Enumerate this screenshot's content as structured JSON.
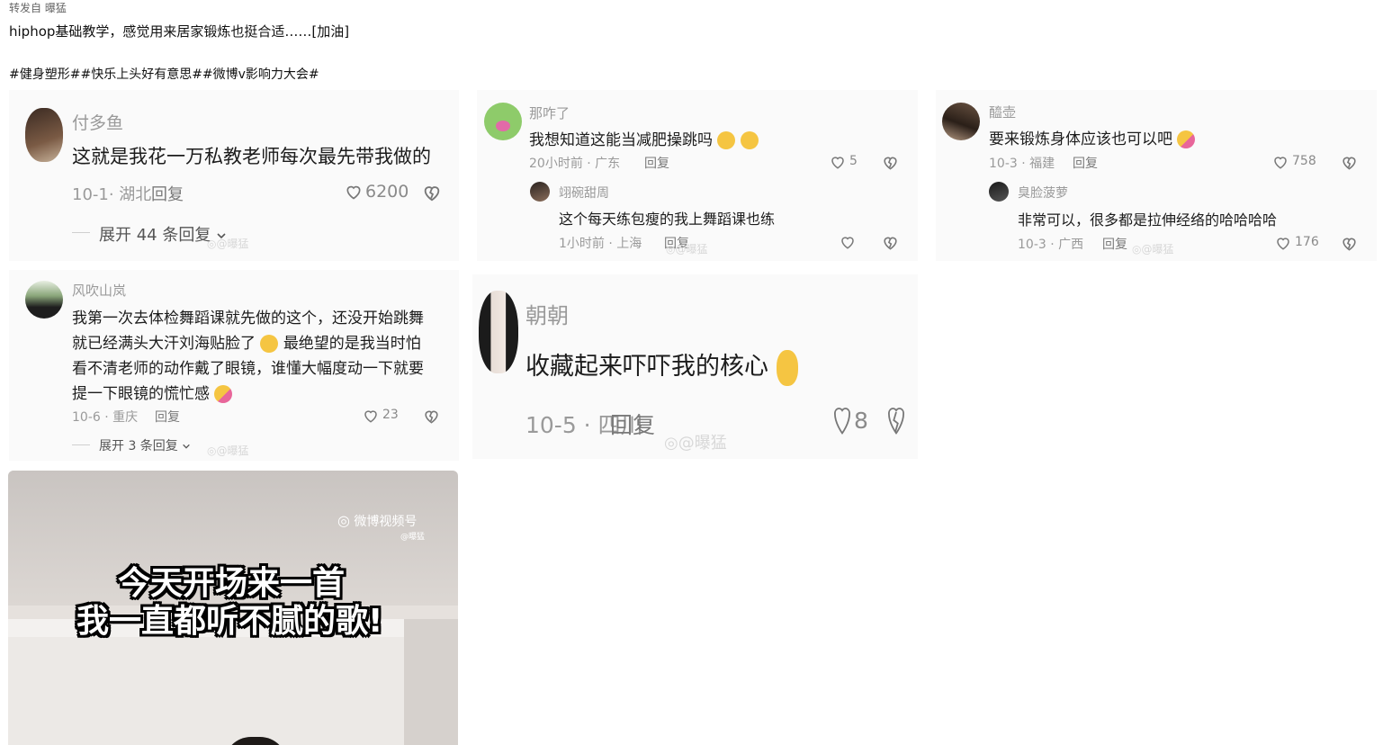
{
  "post": {
    "repost_from": "转发自 曝猛",
    "text": "hiphop基础教学，感觉用来居家锻炼也挺合适……[加油]",
    "hashtags": "#健身塑形##快乐上头好有意思##微博v影响力大会#"
  },
  "watermark": "@曝猛",
  "comments": {
    "c1": {
      "name": "付多鱼",
      "text": "这就是我花一万私教老师每次最先带我做的",
      "meta": "10-1· 湖北",
      "reply": "回复",
      "likes": "6200",
      "expand": "展开 44 条回复"
    },
    "c2": {
      "name": "那咋了",
      "text": "我想知道这能当减肥操跳吗",
      "meta": "20小时前 · 广东",
      "reply": "回复",
      "likes": "5",
      "sub": {
        "name": "翊碗甜周",
        "text": "这个每天练包瘦的我上舞蹈课也练",
        "meta": "1小时前 · 上海",
        "reply": "回复"
      }
    },
    "c3": {
      "name": "醯壶",
      "text": "要来锻炼身体应该也可以吧",
      "meta": "10-3 · 福建",
      "reply": "回复",
      "likes": "758",
      "sub": {
        "name": "臭脸菠萝",
        "text": "非常可以，很多都是拉伸经络的哈哈哈哈",
        "meta": "10-3 · 广西",
        "reply": "回复",
        "likes": "176"
      }
    },
    "c4": {
      "name": "风吹山岚",
      "lines": [
        "我第一次去体检舞蹈课就先做的这个，还没开始跳舞",
        "就已经满头大汗刘海贴脸了",
        "最绝望的是我当时怕",
        "看不清老师的动作戴了眼镜，谁懂大幅度动一下就要",
        "提一下眼镜的慌忙感"
      ],
      "meta": "10-6 · 重庆",
      "reply": "回复",
      "likes": "23",
      "expand": "展开 3 条回复"
    },
    "c5": {
      "name": "朝朝",
      "text": "收藏起来吓吓我的核心",
      "meta": "10-5 · 四川",
      "reply": "回复",
      "likes": "8"
    }
  },
  "video": {
    "logo_text": "微博视频号",
    "logo_sub": "@曝猛",
    "caption_line1": "今天开场来一首",
    "caption_line2": "我一直都听不腻的歌!"
  },
  "icons": {
    "heart": "heart-icon",
    "dislike": "broken-heart-icon",
    "chevron": "chevron-down-icon",
    "weibo": "weibo-logo-icon"
  },
  "colors": {
    "meta_gray": "#9a9a9a",
    "card_bg": "#fafafa",
    "emoji_yellow": "#f5c542"
  }
}
